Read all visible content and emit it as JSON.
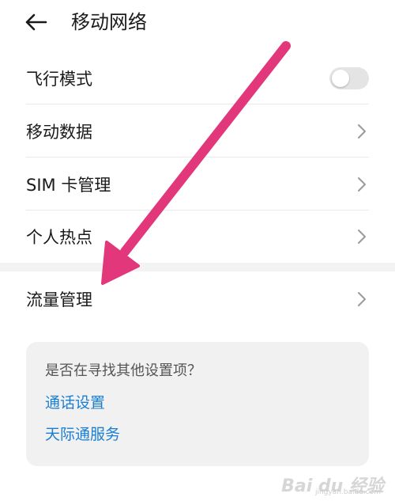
{
  "header": {
    "title": "移动网络"
  },
  "settings": [
    {
      "label": "飞行模式",
      "control": "toggle",
      "toggle_on": false
    },
    {
      "label": "移动数据",
      "control": "chevron"
    },
    {
      "label": "SIM 卡管理",
      "control": "chevron"
    },
    {
      "label": "个人热点",
      "control": "chevron"
    },
    {
      "label": "流量管理",
      "control": "chevron"
    }
  ],
  "suggestions": {
    "question": "是否在寻找其他设置项？",
    "links": [
      {
        "label": "通话设置"
      },
      {
        "label": "天际通服务"
      }
    ]
  },
  "watermark": {
    "text": "Bai du 经验",
    "subtext": "jingyan.baidu.com"
  },
  "colors": {
    "link": "#1a7fd4",
    "annotation_arrow": "#e2377a",
    "card_background": "#f1f1f1"
  }
}
